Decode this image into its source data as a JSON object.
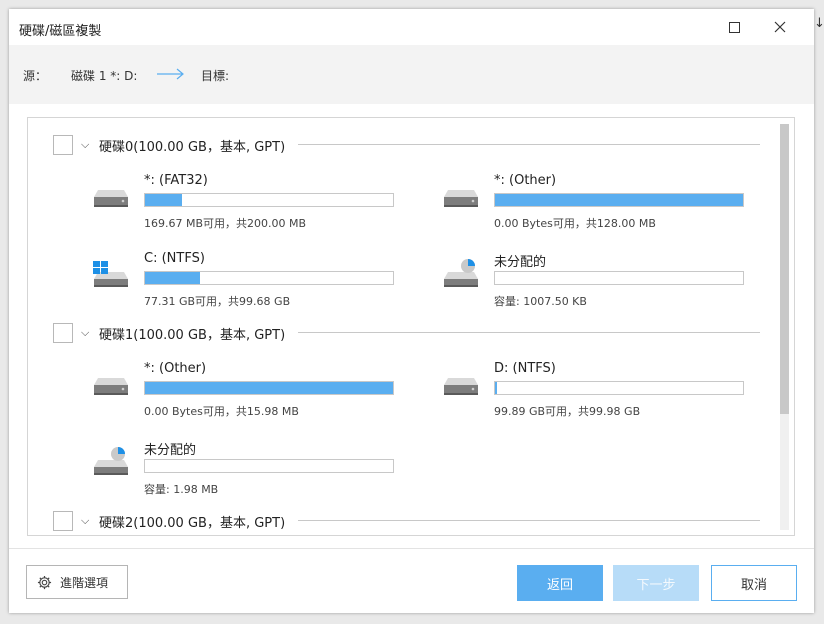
{
  "window": {
    "title": "硬碟/磁區複製",
    "maximize_icon": "□",
    "close_icon": "✕"
  },
  "edge_arrow": "↓",
  "route": {
    "source_label": "源：",
    "source_value": "磁碟 1 *: D:",
    "target_label": "目標:"
  },
  "disks": [
    {
      "label": "硬碟0(100.00 GB，基本, GPT)",
      "partitions": [
        {
          "name": "*: (FAT32)",
          "info": "169.67 MB可用，共200.00 MB",
          "used_fraction": 0.15,
          "icon": "drive-icon"
        },
        {
          "name": "*: (Other)",
          "info": "0.00 Bytes可用，共128.00 MB",
          "used_fraction": 1.0,
          "icon": "drive-icon"
        },
        {
          "name": "C: (NTFS)",
          "info": "77.31 GB可用，共99.68 GB",
          "used_fraction": 0.22,
          "icon": "windows-drive-icon"
        },
        {
          "name": "未分配的",
          "info": "容量: 1007.50 KB",
          "used_fraction": 0.0,
          "icon": "unallocated-icon"
        }
      ]
    },
    {
      "label": "硬碟1(100.00 GB，基本, GPT)",
      "partitions": [
        {
          "name": "*: (Other)",
          "info": "0.00 Bytes可用，共15.98 MB",
          "used_fraction": 1.0,
          "icon": "drive-icon"
        },
        {
          "name": "D: (NTFS)",
          "info": "99.89 GB可用，共99.98 GB",
          "used_fraction": 0.01,
          "icon": "drive-icon"
        },
        {
          "name": "未分配的",
          "info": "容量: 1.98 MB",
          "used_fraction": 0.0,
          "icon": "unallocated-icon"
        }
      ]
    },
    {
      "label": "硬碟2(100.00 GB，基本, GPT)",
      "partitions": []
    }
  ],
  "footer": {
    "advanced_label": "進階選項",
    "back_label": "返回",
    "next_label": "下一步",
    "cancel_label": "取消"
  },
  "colors": {
    "accent": "#5aaef0",
    "disabled": "#b7dcf8"
  }
}
